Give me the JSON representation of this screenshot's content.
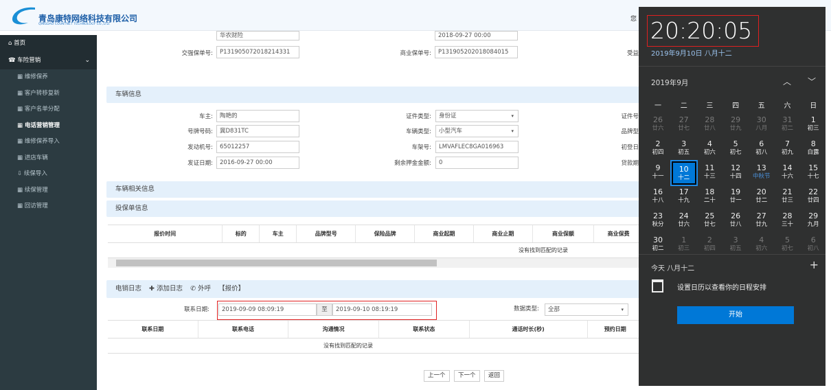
{
  "header": {
    "company_cn": "青岛康特网络科技有限公司",
    "company_en": "QINGDAO COUNTNET TECHNOLOGY CO.,LTD.",
    "user_partial": "您"
  },
  "sidebar": {
    "home": "首页",
    "section": "车险营销",
    "items": [
      "维修保养",
      "客户转移复新",
      "客户名单分配",
      "电话营销管理",
      "维修保养导入",
      "进店车辆",
      "续保导入",
      "续保管理",
      "回访管理"
    ]
  },
  "policy": {
    "top_value1": "华农财险",
    "top_value2": "2018-09-27 00:00",
    "jq_label": "交强保单号:",
    "jq_value": "P131905072018214331",
    "sy_label": "商业保单号:",
    "sy_value": "P131905202018084015",
    "right_label": "受益"
  },
  "vehicle": {
    "title": "车辆信息",
    "owner_label": "车主:",
    "owner": "陶艳的",
    "plate_label": "号牌号码:",
    "plate": "冀D831TC",
    "engine_label": "发动机号:",
    "engine": "65012257",
    "issue_label": "发证日期:",
    "issue": "2016-09-27 00:00",
    "idtype_label": "证件类型:",
    "idtype": "身份证",
    "vtype_label": "车辆类型:",
    "vtype": "小型汽车",
    "vin_label": "车架号:",
    "vin": "LMVAFLEC8GA016963",
    "deposit_label": "剩余押金金额:",
    "deposit": "0",
    "right_labels": [
      "证件号",
      "品牌型",
      "初登日",
      "贷款期"
    ]
  },
  "related": {
    "title": "车辆相关信息"
  },
  "quote": {
    "title": "投保单信息",
    "columns": [
      "报价时间",
      "标的",
      "车主",
      "品牌型号",
      "保险品牌",
      "商业起期",
      "商业止期",
      "商业保额",
      "商业保费"
    ],
    "empty": "没有找到匹配的记录"
  },
  "log": {
    "title": "电销日志",
    "add": "添加日志",
    "call": "外呼",
    "quote": "【报价】",
    "date_label": "联系日期:",
    "date_from": "2019-09-09 08:09:19",
    "to": "至",
    "date_to": "2019-09-10 08:19:19",
    "type_label": "数据类型:",
    "type_value": "全部",
    "columns": [
      "联系日期",
      "联系电话",
      "沟通情况",
      "联系状态",
      "通话时长(秒)",
      "预约日期"
    ],
    "empty": "没有找到匹配的记录"
  },
  "footer": {
    "prev": "上一个",
    "next": "下一个",
    "back": "返回"
  },
  "clock": {
    "time": "20:20:05",
    "date": "2019年9月10日 八月十二",
    "month": "2019年9月",
    "weekdays": [
      "一",
      "二",
      "三",
      "四",
      "五",
      "六",
      "日"
    ],
    "days": [
      [
        "26",
        "廿六",
        1
      ],
      [
        "27",
        "廿七",
        1
      ],
      [
        "28",
        "廿八",
        1
      ],
      [
        "29",
        "廿九",
        1
      ],
      [
        "30",
        "八月",
        1
      ],
      [
        "31",
        "初二",
        1
      ],
      [
        "1",
        "初三",
        0
      ],
      [
        "2",
        "初四",
        0
      ],
      [
        "3",
        "初五",
        0
      ],
      [
        "4",
        "初六",
        0
      ],
      [
        "5",
        "初七",
        0
      ],
      [
        "6",
        "初八",
        0
      ],
      [
        "7",
        "初九",
        0
      ],
      [
        "8",
        "白露",
        0
      ],
      [
        "9",
        "十一",
        0
      ],
      [
        "10",
        "十二",
        2
      ],
      [
        "11",
        "十三",
        0
      ],
      [
        "12",
        "十四",
        0
      ],
      [
        "13",
        "中秋节",
        3
      ],
      [
        "14",
        "十六",
        0
      ],
      [
        "15",
        "十七",
        0
      ],
      [
        "16",
        "十八",
        0
      ],
      [
        "17",
        "十九",
        0
      ],
      [
        "18",
        "二十",
        0
      ],
      [
        "19",
        "廿一",
        0
      ],
      [
        "20",
        "廿二",
        0
      ],
      [
        "21",
        "廿三",
        0
      ],
      [
        "22",
        "廿四",
        0
      ],
      [
        "23",
        "秋分",
        0
      ],
      [
        "24",
        "廿六",
        0
      ],
      [
        "25",
        "廿七",
        0
      ],
      [
        "26",
        "廿八",
        0
      ],
      [
        "27",
        "廿九",
        0
      ],
      [
        "28",
        "三十",
        0
      ],
      [
        "29",
        "九月",
        0
      ],
      [
        "30",
        "初二",
        0
      ],
      [
        "1",
        "初三",
        1
      ],
      [
        "2",
        "初四",
        1
      ],
      [
        "3",
        "初五",
        1
      ],
      [
        "4",
        "初六",
        1
      ],
      [
        "5",
        "初七",
        1
      ],
      [
        "6",
        "初八",
        1
      ]
    ],
    "today": "今天 八月十二",
    "schedule": "设置日历以查看你的日程安排",
    "start": "开始"
  }
}
